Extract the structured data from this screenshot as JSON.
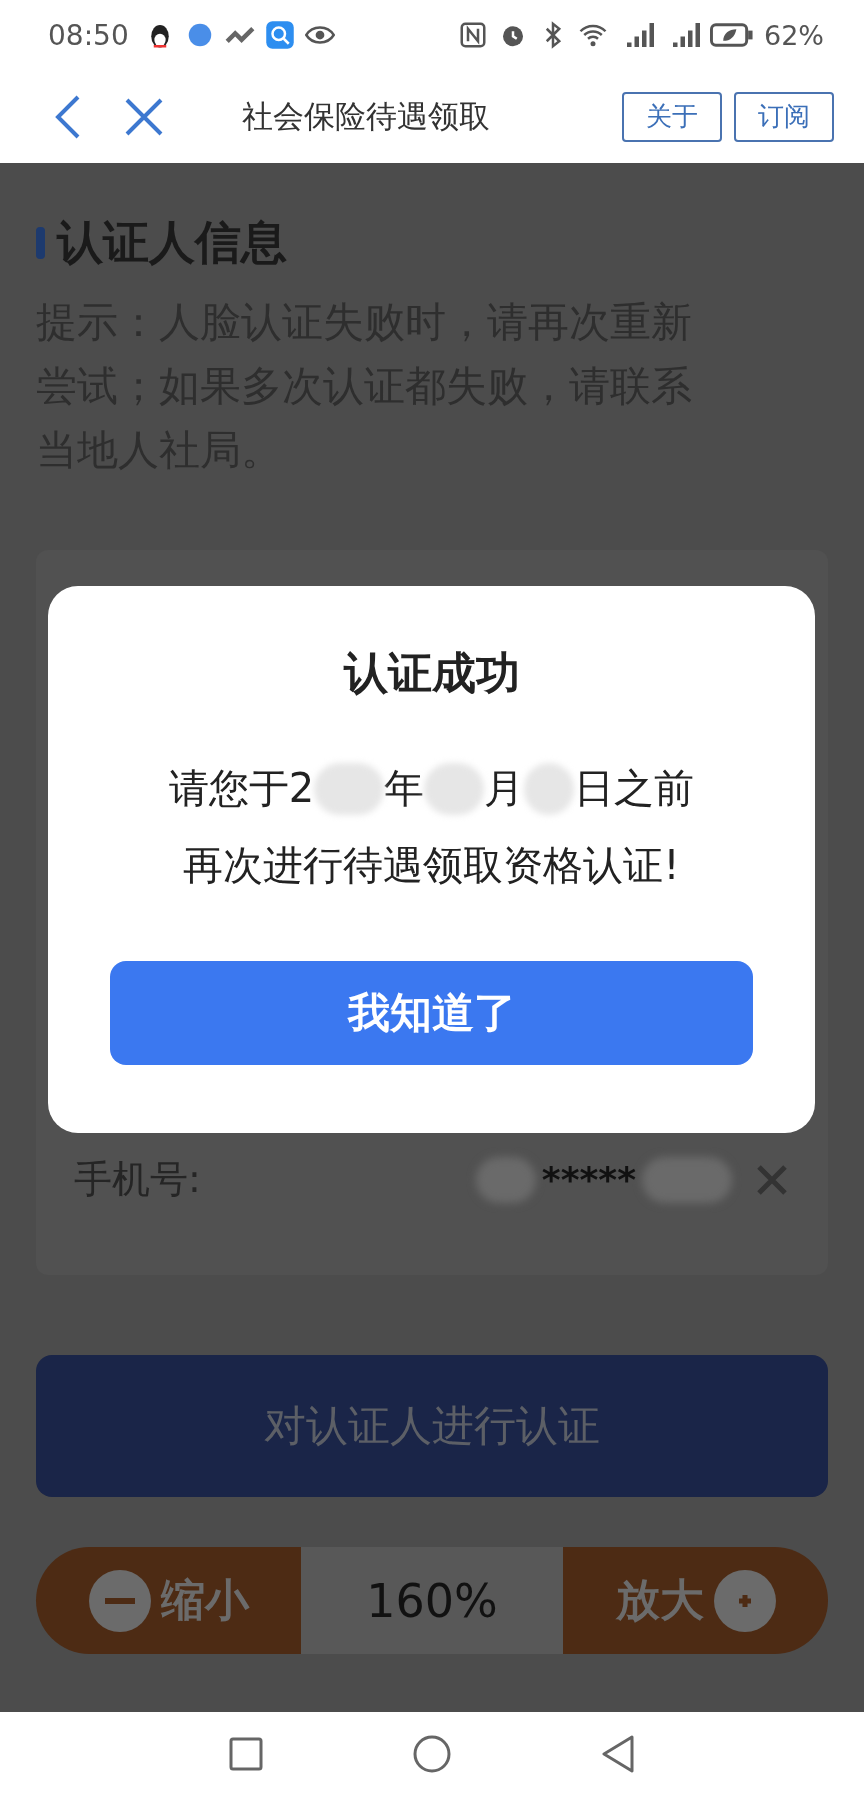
{
  "status_bar": {
    "time": "08:50",
    "battery": "62%"
  },
  "header": {
    "title": "社会保险待遇领取",
    "buttons": [
      "关于",
      "订阅"
    ]
  },
  "section": {
    "title": "认证人信息",
    "hint": "提示：人脸认证失败时，请再次重新尝试；如果多次认证都失败，请联系当地人社局。"
  },
  "form": {
    "phone": {
      "label": "手机号:",
      "value": "*****"
    }
  },
  "auth_button": "对认证人进行认证",
  "zoom_bar": {
    "zoom_out": "缩小",
    "value": "160%",
    "zoom_in": "放大"
  },
  "dialog": {
    "title": "认证成功",
    "message_line1": [
      {
        "kind": "text",
        "text": "请您于2"
      },
      {
        "kind": "redacted"
      },
      {
        "kind": "text",
        "text": "年"
      },
      {
        "kind": "redacted"
      },
      {
        "kind": "text",
        "text": "月"
      },
      {
        "kind": "redacted"
      },
      {
        "kind": "text",
        "text": "日之前"
      }
    ],
    "message_line2": "再次进行待遇领取资格认证!",
    "button": "我知道了"
  }
}
